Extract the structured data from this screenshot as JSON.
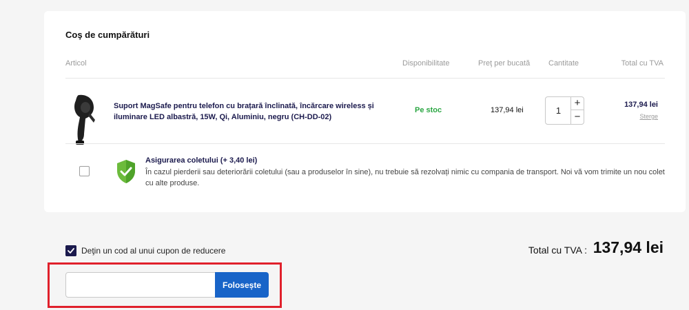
{
  "cart": {
    "title": "Coş de cumpărături",
    "columns": {
      "article": "Articol",
      "availability": "Disponibilitate",
      "unit_price": "Preţ per bucată",
      "quantity": "Cantitate",
      "total": "Total cu TVA"
    },
    "item": {
      "name": "Suport MagSafe pentru telefon cu brațară înclinată, încărcare wireless și iluminare LED albastră, 15W, Qi, Aluminiu, negru (CH-DD-02)",
      "availability": "Pe stoc",
      "unit_price": "137,94 lei",
      "quantity": "1",
      "plus": "+",
      "minus": "−",
      "total": "137,94 lei",
      "remove": "Sterge",
      "image_icon": "phone-mount-image"
    },
    "insurance": {
      "title": "Asigurarea coletului (+ 3,40 lei)",
      "description": "În cazul pierderii sau deteriorării coletului (sau a produselor în sine), nu trebuie să rezolvați nimic cu compania de transport. Noi vă vom trimite un nou colet cu alte produse.",
      "checked": false,
      "icon": "shield-check-icon"
    }
  },
  "coupon": {
    "checkbox_label": "Deţin un cod al unui cupon de reducere",
    "checked": true,
    "input_value": "",
    "apply_label": "Folosește"
  },
  "summary": {
    "total_label": "Total cu TVA :",
    "total_value": "137,94 lei"
  },
  "colors": {
    "accent_blue": "#1864c8",
    "navy": "#1b1a4d",
    "stock_green": "#2aa642",
    "highlight_red": "#e0202b"
  }
}
